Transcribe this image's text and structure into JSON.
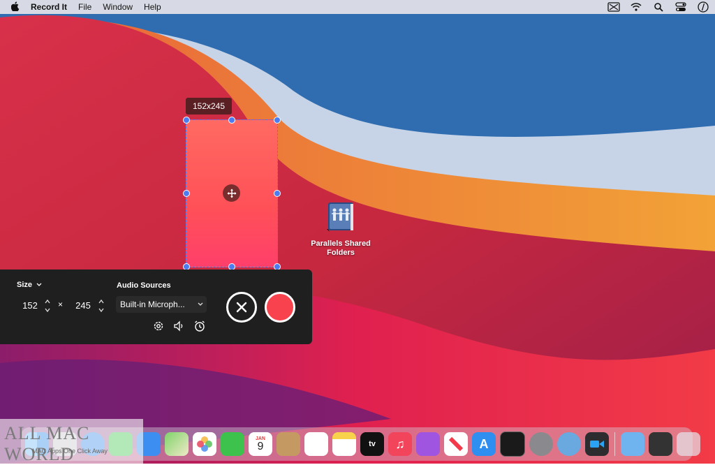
{
  "menubar": {
    "app_name": "Record It",
    "menus": [
      "File",
      "Window",
      "Help"
    ],
    "status_icons": [
      "screen-record-icon",
      "wifi-icon",
      "search-icon",
      "control-center-icon",
      "clock-icon"
    ]
  },
  "selection": {
    "size_label": "152x245"
  },
  "desktop_icon": {
    "label_line1": "Parallels Shared",
    "label_line2": "Folders"
  },
  "panel": {
    "size_label": "Size",
    "width": "152",
    "height": "245",
    "times": "×",
    "audio_label": "Audio Sources",
    "audio_source": "Built-in Microph...",
    "icons": [
      "settings-icon",
      "speaker-icon",
      "timer-icon"
    ]
  },
  "dock": {
    "calendar_month": "JAN",
    "calendar_day": "9",
    "tv_label": "tv"
  },
  "watermark": {
    "title": "ALL MAC WORLD",
    "subtitle": "MAC Apps One Click Away"
  },
  "colors": {
    "record": "#f8424e",
    "selection_border": "#4c7cf0",
    "panel_bg": "#1f1f1f"
  }
}
